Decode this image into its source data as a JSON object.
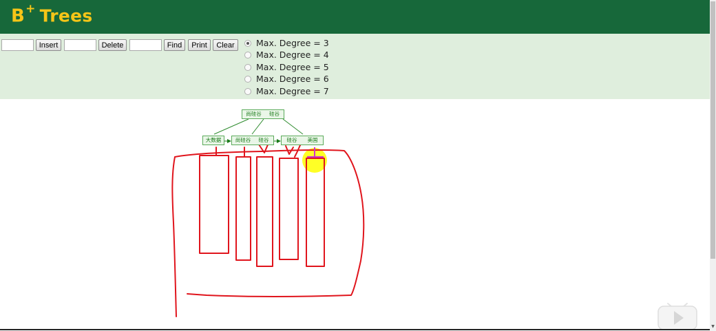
{
  "header": {
    "title_main": "B",
    "title_sup": "+",
    "title_rest": "Trees",
    "background": "#17683a",
    "title_color": "#f5c518"
  },
  "controls": {
    "insert_value": "",
    "insert_label": "Insert",
    "delete_value": "",
    "delete_label": "Delete",
    "find_value": "",
    "find_label": "Find",
    "print_label": "Print",
    "clear_label": "Clear",
    "degree_options": [
      {
        "label": "Max. Degree = 3",
        "selected": true
      },
      {
        "label": "Max. Degree = 4",
        "selected": false
      },
      {
        "label": "Max. Degree = 5",
        "selected": false
      },
      {
        "label": "Max. Degree = 6",
        "selected": false
      },
      {
        "label": "Max. Degree = 7",
        "selected": false
      }
    ],
    "background": "#dfeedd"
  },
  "tree": {
    "root": {
      "keys": [
        "尚硅谷",
        "硅谷"
      ]
    },
    "leaves": [
      {
        "keys": [
          "大数据"
        ]
      },
      {
        "keys": [
          "尚硅谷",
          "硅谷"
        ]
      },
      {
        "keys": [
          "硅谷",
          "美国"
        ]
      }
    ],
    "node_color": "#187a18",
    "annotation_color": "#e0141c",
    "highlight_color": "#ffff00",
    "pointer_color": "#cc33cc"
  },
  "overlay": {
    "icon": "play-icon"
  }
}
